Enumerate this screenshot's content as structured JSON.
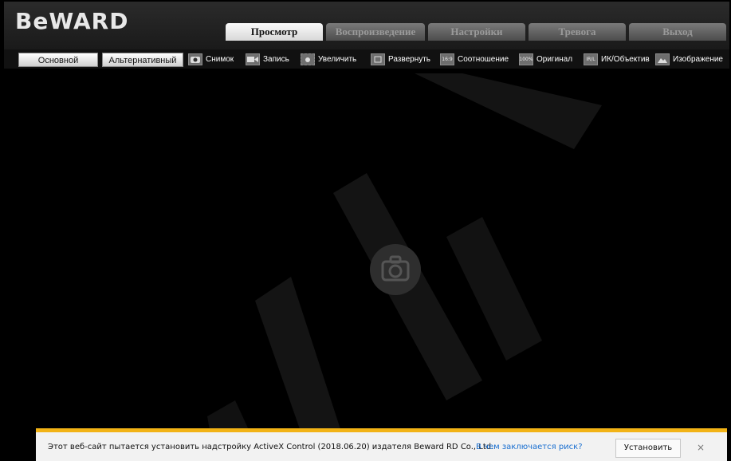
{
  "logo": "BeWARD",
  "tabs": [
    {
      "label": "Просмотр",
      "active": true
    },
    {
      "label": "Воспроизведение",
      "active": false
    },
    {
      "label": "Настройки",
      "active": false
    },
    {
      "label": "Тревога",
      "active": false
    },
    {
      "label": "Выход",
      "active": false
    }
  ],
  "streams": {
    "main": "Основной",
    "alt": "Альтернативный"
  },
  "tools": [
    {
      "label": "Снимок",
      "icon": "camera-snapshot-icon"
    },
    {
      "label": "Запись",
      "icon": "video-record-icon"
    },
    {
      "label": "Увеличить",
      "icon": "zoom-area-icon"
    },
    {
      "label": "Развернуть",
      "icon": "fullscreen-icon"
    },
    {
      "label": "Соотношение",
      "icon": "aspect-ratio-icon",
      "glyph": "16:9"
    },
    {
      "label": "Оригинал",
      "icon": "original-size-icon",
      "glyph": "100%"
    },
    {
      "label": "ИК/Объектив",
      "icon": "ir-lens-icon",
      "glyph": "IR/L"
    },
    {
      "label": "Изображение",
      "icon": "image-settings-icon"
    }
  ],
  "notification": {
    "message": "Этот веб-сайт пытается установить надстройку ActiveX Control (2018.06.20) издателя Beward RD Co., Ltd.",
    "link": "В чем заключается риск?",
    "install": "Установить",
    "close": "×"
  },
  "colors": {
    "accent": "#f2b316",
    "background": "#000000",
    "link": "#1a6fd0"
  }
}
